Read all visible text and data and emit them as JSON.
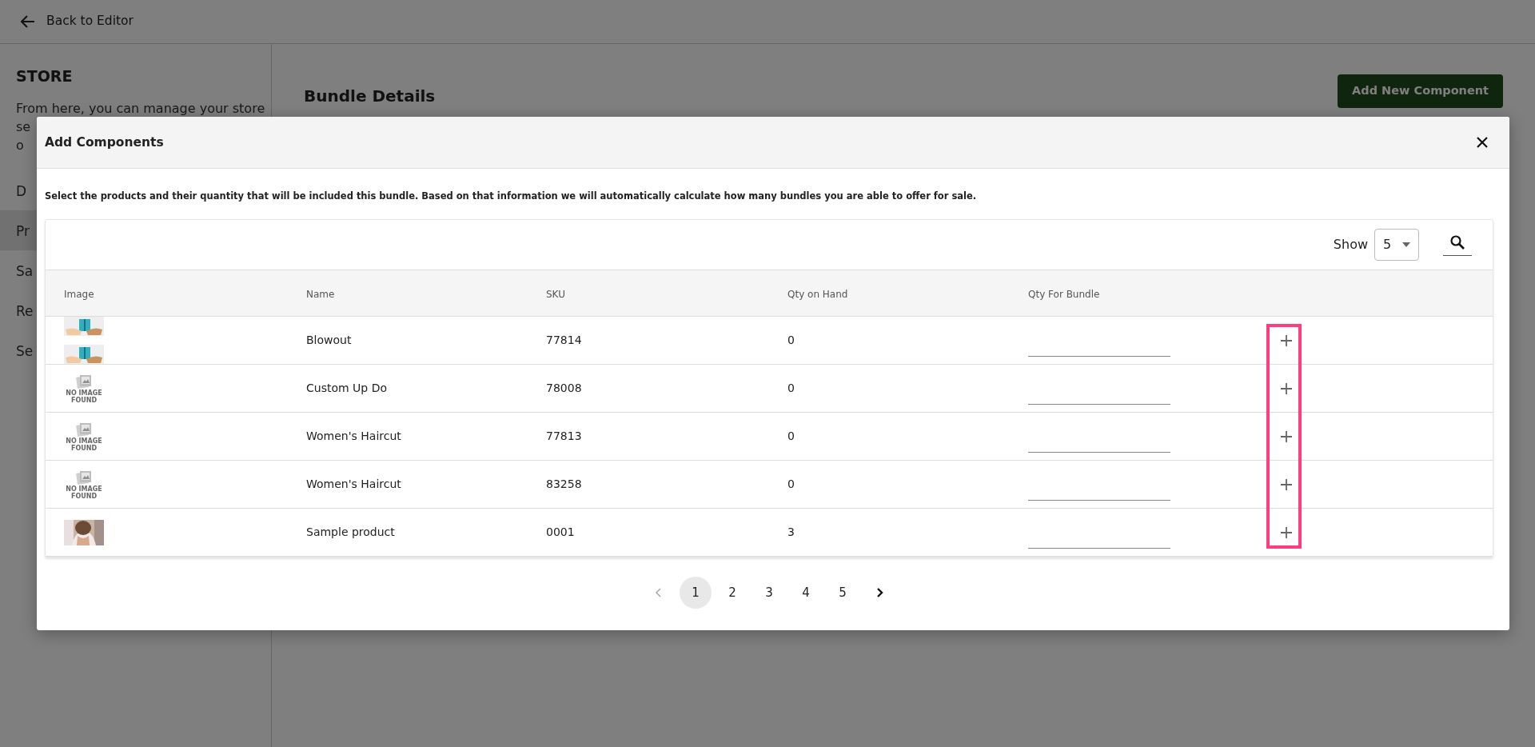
{
  "top_bar": {
    "back_label": "Back to Editor"
  },
  "sidebar": {
    "title": "STORE",
    "description_lines": [
      "From here, you can manage your store",
      "se",
      "o"
    ],
    "items": [
      {
        "label": "D",
        "selected": false
      },
      {
        "label": "Pr",
        "selected": true
      },
      {
        "label": "Sa",
        "selected": false
      },
      {
        "label": "Re",
        "selected": false
      },
      {
        "label": "Se",
        "selected": false
      }
    ]
  },
  "main": {
    "title": "Bundle Details",
    "button": "Add New Component"
  },
  "modal": {
    "title": "Add Components",
    "description": "Select the products and their quantity that will be included this bundle. Based on that information we will automatically calculate how many bundles you are able to offer for sale.",
    "show_label": "Show",
    "page_size": "5",
    "columns": [
      "Image",
      "Name",
      "SKU",
      "Qty on Hand",
      "Qty For Bundle"
    ],
    "rows": [
      {
        "images": [
          {
            "kind": "gift"
          },
          {
            "kind": "gift"
          }
        ],
        "name": "Blowout",
        "sku": "77814",
        "qty_on_hand": "0"
      },
      {
        "images": [
          {
            "kind": "no-image",
            "text": "NO IMAGE FOUND"
          }
        ],
        "name": "Custom Up Do",
        "sku": "78008",
        "qty_on_hand": "0"
      },
      {
        "images": [
          {
            "kind": "no-image",
            "text": "NO IMAGE FOUND"
          }
        ],
        "name": "Women's Haircut",
        "sku": "77813",
        "qty_on_hand": "0"
      },
      {
        "images": [
          {
            "kind": "no-image",
            "text": "NO IMAGE FOUND"
          }
        ],
        "name": "Women's Haircut",
        "sku": "83258",
        "qty_on_hand": "0"
      },
      {
        "name": "Sample product",
        "sku": "0001",
        "qty_on_hand": "3"
      }
    ],
    "add_column_highlighted": true,
    "pagination": {
      "prev_disabled": true,
      "next_disabled": false,
      "pages": [
        {
          "label": "1",
          "selected": true
        },
        {
          "label": "2",
          "selected": false
        },
        {
          "label": "3",
          "selected": false
        },
        {
          "label": "4",
          "selected": false
        },
        {
          "label": "5",
          "selected": false
        }
      ]
    }
  }
}
